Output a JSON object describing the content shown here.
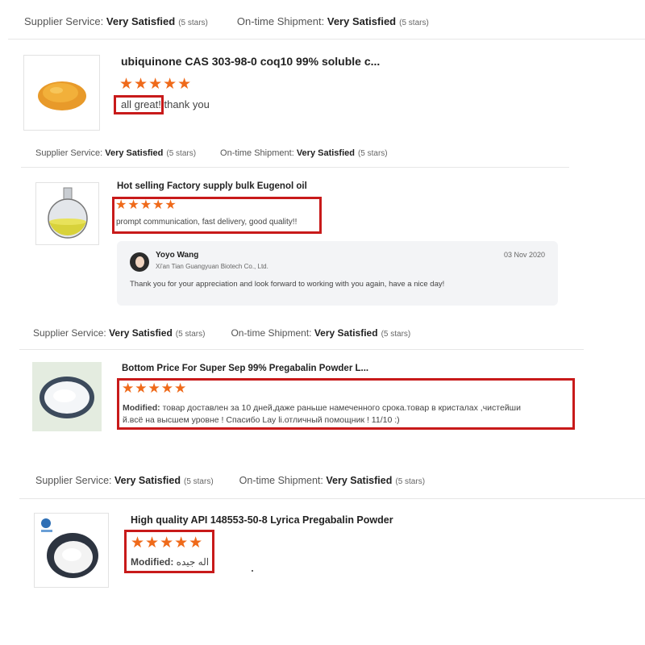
{
  "reviews": [
    {
      "supplier_label": "Supplier Service:",
      "supplier_value": "Very Satisfied",
      "supplier_stars": "(5 stars)",
      "shipment_label": "On-time Shipment:",
      "shipment_value": "Very Satisfied",
      "shipment_stars": "(5 stars)",
      "title": "ubiquinone CAS 303-98-0 coq10 99% soluble c...",
      "stars": "★★★★★",
      "comment": "all great! thank you"
    },
    {
      "supplier_label": "Supplier Service:",
      "supplier_value": "Very Satisfied",
      "supplier_stars": "(5 stars)",
      "shipment_label": "On-time Shipment:",
      "shipment_value": "Very Satisfied",
      "shipment_stars": "(5 stars)",
      "title": "Hot selling Factory supply bulk Eugenol oil",
      "stars": "★★★★★",
      "comment": "prompt communication, fast delivery, good quality!!",
      "reply": {
        "name": "Yoyo Wang",
        "company": "Xi'an Tian Guangyuan Biotech Co., Ltd.",
        "date": "03 Nov 2020",
        "text": "Thank you for your appreciation and look forward to working with you again, have a nice day!"
      }
    },
    {
      "supplier_label": "Supplier Service:",
      "supplier_value": "Very Satisfied",
      "supplier_stars": "(5 stars)",
      "shipment_label": "On-time Shipment:",
      "shipment_value": "Very Satisfied",
      "shipment_stars": "(5 stars)",
      "title": "Bottom Price For Super Sep 99% Pregabalin Powder L...",
      "stars": "★★★★★",
      "modified_label": "Modified:",
      "comment_line1": "товар доставлен за 10 дней,даже раньше намеченного срока.товар в кристалах ,чистейши",
      "comment_line2": "й.всё на высшем уровне ! Спасибо Lay li.отличный помощник ! 11/10 :)"
    },
    {
      "supplier_label": "Supplier Service:",
      "supplier_value": "Very Satisfied",
      "supplier_stars": "(5 stars)",
      "shipment_label": "On-time Shipment:",
      "shipment_value": "Very Satisfied",
      "shipment_stars": "(5 stars)",
      "title": "High quality API 148553-50-8 Lyrica Pregabalin Powder",
      "stars": "★★★★★",
      "modified_label": "Modified:",
      "comment": "اله جيده"
    }
  ],
  "colors": {
    "star": "#ef6a1a",
    "highlight_box": "#c81a1a"
  }
}
